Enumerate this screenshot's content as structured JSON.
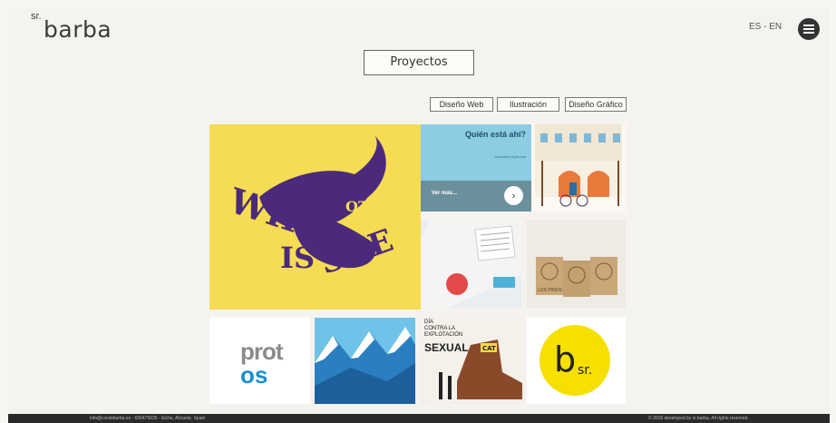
{
  "header": {
    "logo_sr": "sr.",
    "logo_name": "barba",
    "lang": "ES - EN"
  },
  "section": {
    "title": "Proyectos"
  },
  "filters": [
    "Diseño Web",
    "Ilustración",
    "Diseño Gráfico"
  ],
  "projects": {
    "who_is_she": {
      "word1": "WHO",
      "word2": "IS",
      "word3": "SHE"
    },
    "quien": {
      "title": "Quién está ahí?",
      "subtitle": "Ilustración Aplicada",
      "cta": "Ver más..."
    },
    "cups_label": "LOS PINOS",
    "protos": {
      "top": "prot",
      "bottom": "os"
    },
    "dia": {
      "line1": "DÍA",
      "line2": "CONTRA LA",
      "line3": "EXPLOTACIÓN",
      "line4": "SEXUAL",
      "cat": "CAT"
    },
    "bsr": {
      "b": "b",
      "sr": "sr."
    }
  },
  "footer": {
    "left": "info@cordobarba.es - 656475635 - Elche, Alicante, Spain",
    "right": "© 2016 developed by sr.barba. All rights reserved."
  },
  "colors": {
    "yellow": "#f5dc52",
    "purple": "#4b2a7b",
    "light_blue": "#8ccde3",
    "blue": "#1a8fd1"
  }
}
